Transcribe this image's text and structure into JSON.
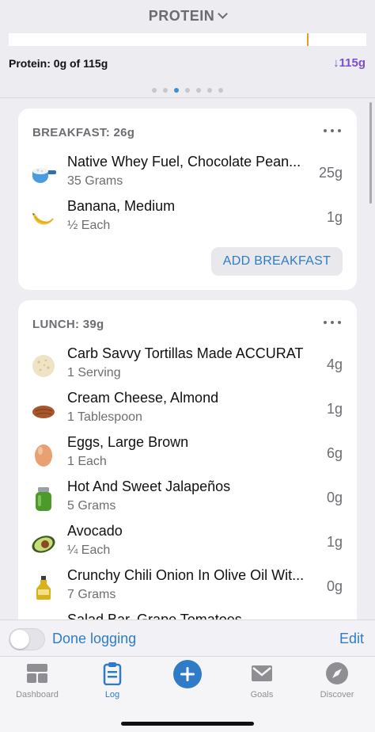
{
  "header": {
    "nutrient": "PROTEIN",
    "summary": "Protein: 0g of 115g",
    "goal_label": "↓115g",
    "progress_fraction": 0.0,
    "goal_marker_fraction": 0.835,
    "page_count": 7,
    "active_page": 3,
    "accent_colors": {
      "goal": "#7b4fd6",
      "marker": "#e0a030",
      "link": "#2e7cc8"
    }
  },
  "meals": [
    {
      "title": "BREAKFAST: 26g",
      "items": [
        {
          "name": "Native Whey Fuel, Chocolate Pean...",
          "serving": "35 Grams",
          "value": "25g",
          "icon": "protein-powder-scoop-icon"
        },
        {
          "name": "Banana, Medium",
          "serving": "½ Each",
          "value": "1g",
          "icon": "banana-icon"
        }
      ],
      "add_label": "ADD BREAKFAST"
    },
    {
      "title": "LUNCH: 39g",
      "items": [
        {
          "name": "Carb Savvy Tortillas Made ACCURAT",
          "serving": "1 Serving",
          "value": "4g",
          "icon": "tortilla-icon"
        },
        {
          "name": "Cream Cheese, Almond",
          "serving": "1 Tablespoon",
          "value": "1g",
          "icon": "almond-icon"
        },
        {
          "name": "Eggs, Large Brown",
          "serving": "1 Each",
          "value": "6g",
          "icon": "egg-icon"
        },
        {
          "name": "Hot And Sweet Jalapeños",
          "serving": "5 Grams",
          "value": "0g",
          "icon": "jar-icon"
        },
        {
          "name": "Avocado",
          "serving": "¼ Each",
          "value": "1g",
          "icon": "avocado-icon"
        },
        {
          "name": "Crunchy Chili Onion In Olive Oil Wit...",
          "serving": "7 Grams",
          "value": "0g",
          "icon": "olive-oil-bottle-icon"
        },
        {
          "name": "Salad Bar, Grape Tomatoes",
          "serving": "",
          "value": "",
          "icon": "tomato-icon"
        }
      ]
    }
  ],
  "done_bar": {
    "label": "Done logging",
    "edit": "Edit",
    "toggle_on": false
  },
  "tabs": [
    {
      "label": "Dashboard",
      "icon": "dashboard-icon",
      "active": false
    },
    {
      "label": "Log",
      "icon": "clipboard-icon",
      "active": true
    },
    {
      "label": "",
      "icon": "plus-icon",
      "active": false
    },
    {
      "label": "Goals",
      "icon": "goals-icon",
      "active": false
    },
    {
      "label": "Discover",
      "icon": "compass-icon",
      "active": false
    }
  ]
}
